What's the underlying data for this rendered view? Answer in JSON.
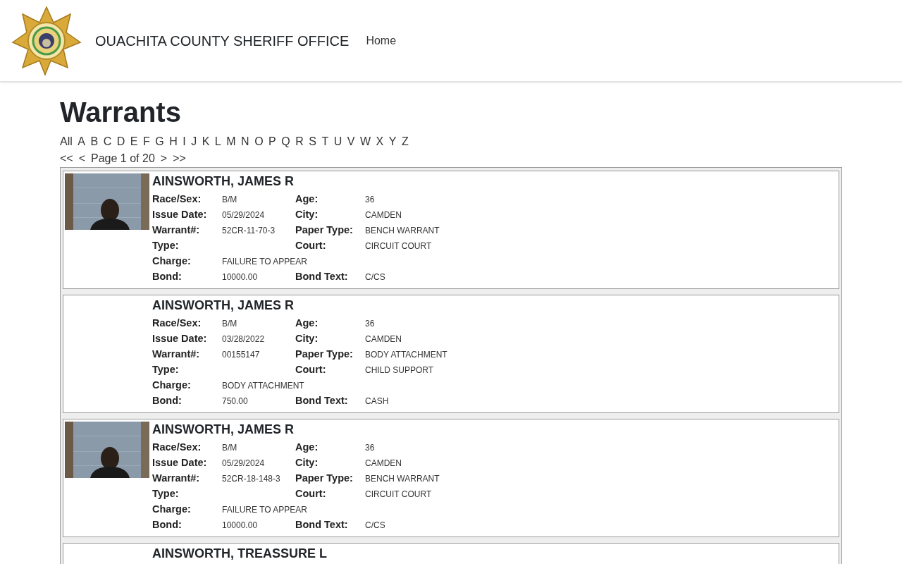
{
  "header": {
    "site_title": "OUACHITA COUNTY SHERIFF OFFICE",
    "nav": [
      {
        "label": "Home"
      }
    ]
  },
  "page_title": "Warrants",
  "letters": [
    "All",
    "A",
    "B",
    "C",
    "D",
    "E",
    "F",
    "G",
    "H",
    "I",
    "J",
    "K",
    "L",
    "M",
    "N",
    "O",
    "P",
    "Q",
    "R",
    "S",
    "T",
    "U",
    "V",
    "W",
    "X",
    "Y",
    "Z"
  ],
  "pager": {
    "first": "<<",
    "prev": "<",
    "label": "Page 1 of 20",
    "next": ">",
    "last": ">>"
  },
  "warrants": [
    {
      "photo": true,
      "name": "AINSWORTH, JAMES R",
      "rows": [
        [
          {
            "label": "Race/Sex:",
            "value": "B/M"
          },
          {
            "label": "Age:",
            "value": "36"
          }
        ],
        [
          {
            "label": "Issue Date:",
            "value": "05/29/2024"
          },
          {
            "label": "City:",
            "value": "CAMDEN"
          }
        ],
        [
          {
            "label": "Warrant#:",
            "value": "52CR-11-70-3"
          },
          {
            "label": "Paper Type:",
            "value": "BENCH WARRANT"
          }
        ],
        [
          {
            "label": "Type:"
          },
          {
            "label": "Court:",
            "value": "CIRCUIT COURT"
          }
        ],
        [
          {
            "label": "Charge:",
            "value": "FAILURE TO APPEAR"
          }
        ],
        [
          {
            "label": "Bond:",
            "value": "10000.00"
          },
          {
            "label": "Bond Text:",
            "value": "C/CS"
          }
        ]
      ]
    },
    {
      "photo": false,
      "name": "AINSWORTH, JAMES R",
      "rows": [
        [
          {
            "label": "Race/Sex:",
            "value": "B/M"
          },
          {
            "label": "Age:",
            "value": "36"
          }
        ],
        [
          {
            "label": "Issue Date:",
            "value": "03/28/2022"
          },
          {
            "label": "City:",
            "value": "CAMDEN"
          }
        ],
        [
          {
            "label": "Warrant#:",
            "value": "00155147"
          },
          {
            "label": "Paper Type:",
            "value": "BODY ATTACHMENT"
          }
        ],
        [
          {
            "label": "Type:"
          },
          {
            "label": "Court:",
            "value": "CHILD SUPPORT"
          }
        ],
        [
          {
            "label": "Charge:",
            "value": "BODY ATTACHMENT"
          }
        ],
        [
          {
            "label": "Bond:",
            "value": "750.00"
          },
          {
            "label": "Bond Text:",
            "value": "CASH"
          }
        ]
      ]
    },
    {
      "photo": true,
      "name": "AINSWORTH, JAMES R",
      "rows": [
        [
          {
            "label": "Race/Sex:",
            "value": "B/M"
          },
          {
            "label": "Age:",
            "value": "36"
          }
        ],
        [
          {
            "label": "Issue Date:",
            "value": "05/29/2024"
          },
          {
            "label": "City:",
            "value": "CAMDEN"
          }
        ],
        [
          {
            "label": "Warrant#:",
            "value": "52CR-18-148-3"
          },
          {
            "label": "Paper Type:",
            "value": "BENCH WARRANT"
          }
        ],
        [
          {
            "label": "Type:"
          },
          {
            "label": "Court:",
            "value": "CIRCUIT COURT"
          }
        ],
        [
          {
            "label": "Charge:",
            "value": "FAILURE TO APPEAR"
          }
        ],
        [
          {
            "label": "Bond:",
            "value": "10000.00"
          },
          {
            "label": "Bond Text:",
            "value": "C/CS"
          }
        ]
      ]
    },
    {
      "photo": false,
      "name": "AINSWORTH, TREASSURE L"
    }
  ]
}
